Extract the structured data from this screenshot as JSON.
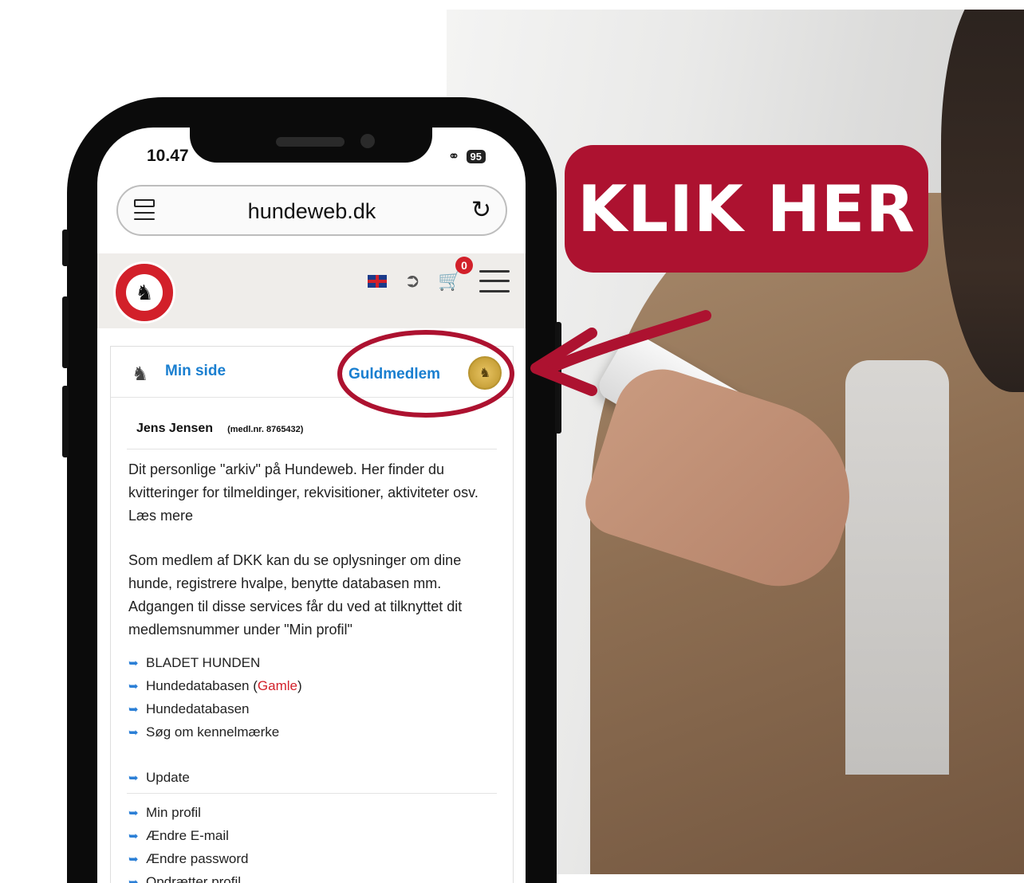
{
  "callout": {
    "text": "KLIK HER",
    "color": "#ad1230"
  },
  "status_bar": {
    "time": "10.47",
    "battery": "95"
  },
  "browser": {
    "url": "hundeweb.dk"
  },
  "header": {
    "cart_count": "0"
  },
  "card": {
    "min_side": "Min side",
    "membership": "Guldmedlem",
    "member_name": "Jens Jensen",
    "member_number": "(medl.nr. 8765432)",
    "intro": "Dit personlige \"arkiv\" på Hundeweb. Her finder du kvitteringer for tilmeldinger, rekvisitioner, aktiviteter osv. Læs mere",
    "info": "Som medlem af DKK kan du se oplysninger om dine hunde, registrere hvalpe, benytte databasen mm. Adgangen til disse services får du ved at tilknyttet dit medlemsnummer under \"Min profil\"",
    "links_group1": {
      "bladet": "BLADET HUNDEN",
      "hundedatabasen_old": "Hundedatabasen (",
      "gamle": "Gamle",
      "close_paren": ")",
      "hundedatabasen": "Hundedatabasen",
      "kennel": "Søg om kennelmærke"
    },
    "update": "Update",
    "links_group3": [
      "Min profil",
      "Ændre E-mail",
      "Ændre password",
      "Opdrætter profil"
    ]
  },
  "accent_colors": {
    "link": "#1a7fd0",
    "red": "#d2202a",
    "highlight": "#ad1230"
  }
}
